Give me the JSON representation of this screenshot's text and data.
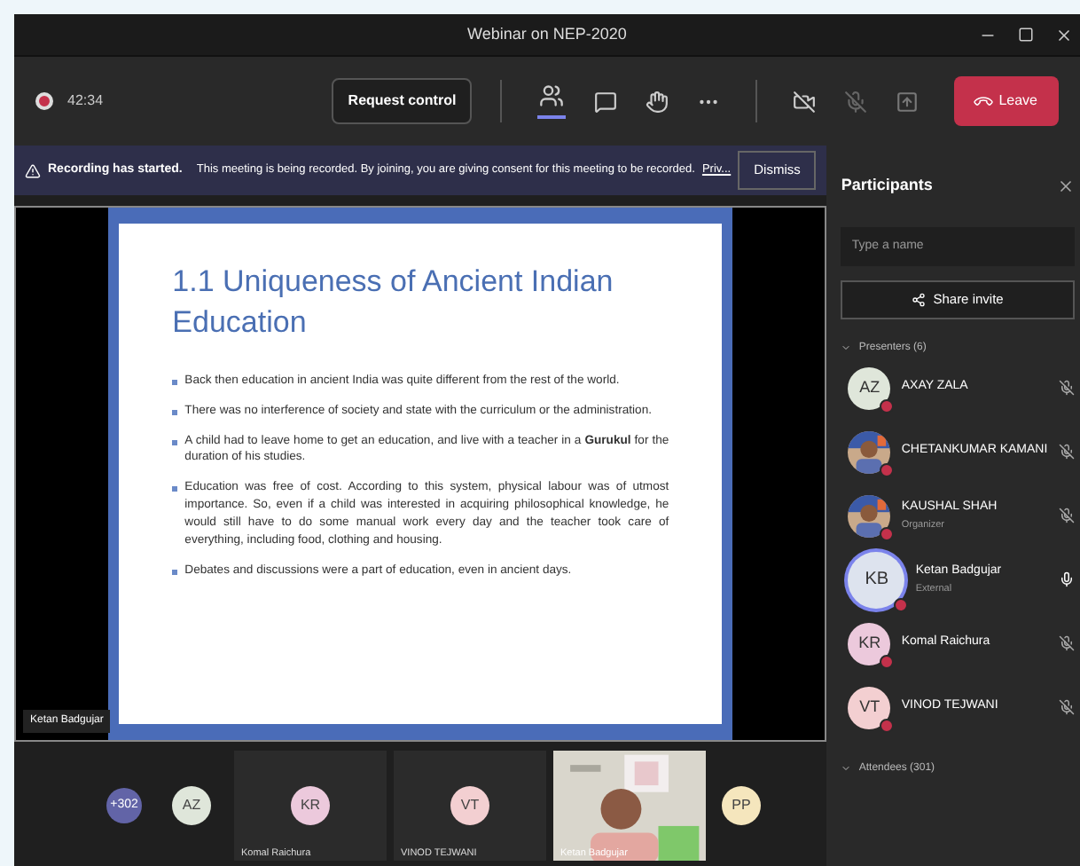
{
  "window": {
    "title": "Webinar on NEP-2020"
  },
  "toolbar": {
    "recording": true,
    "timer": "42:34",
    "request_control": "Request control",
    "people_selected": true,
    "leave": "Leave"
  },
  "banner": {
    "title": "Recording has started.",
    "message": "This meeting is being recorded. By joining, you are giving consent for this meeting to be recorded.",
    "link": "Priv...",
    "dismiss": "Dismiss"
  },
  "slide": {
    "title": "1.1 Uniqueness of Ancient Indian Education",
    "bullets": [
      "Back then education in ancient India was quite different from the rest of the world.",
      "There was no interference of society and state with the curriculum or the administration.",
      "A child had to leave home to get an education, and live with a teacher in a **Gurukul** for the duration of his studies.",
      "Education was free of cost. According to this system, physical labour was of utmost importance. So, even if a child was interested in acquiring philosophical knowledge, he would still have to do some manual work every day and the teacher took care of everything, including food, clothing and housing.",
      "Debates and discussions were a part of education, even in ancient days."
    ],
    "presenter": "Ketan Badgujar"
  },
  "gallery": [
    {
      "kind": "overflow",
      "label": "+302"
    },
    {
      "kind": "initials",
      "label": "AZ",
      "color": "#dfe6da"
    },
    {
      "kind": "initials",
      "label": "KR",
      "color": "#ecc9dc",
      "name": "Komal Raichura"
    },
    {
      "kind": "initials",
      "label": "VT",
      "color": "#f3cfd1",
      "name": "VINOD TEJWANI"
    },
    {
      "kind": "video",
      "name": "Ketan Badgujar"
    },
    {
      "kind": "initials",
      "label": "PP",
      "color": "#f5e6bd"
    }
  ],
  "participants": {
    "title": "Participants",
    "search_placeholder": "Type a name",
    "share_invite": "Share invite",
    "sections": [
      {
        "title": "Presenters (6)",
        "expanded": true,
        "people": [
          {
            "kind": "initials",
            "initials": "AZ",
            "color": "#dfe6da",
            "name": "AXAY ZALA",
            "muted": true,
            "speaking": false
          },
          {
            "name": "CHETANKUMAR KAMANI",
            "muted": true,
            "speaking": false
          },
          {
            "name": "KAUSHAL SHAH",
            "role": "Organizer",
            "muted": true,
            "speaking": false
          },
          {
            "kind": "initials",
            "initials": "KB",
            "color": "#dde3ee",
            "name": "Ketan Badgujar",
            "role": "External",
            "muted": false,
            "speaking": true
          },
          {
            "kind": "initials",
            "initials": "KR",
            "color": "#ecc9dc",
            "name": "Komal Raichura",
            "muted": true,
            "speaking": false
          },
          {
            "kind": "initials",
            "initials": "VT",
            "color": "#f3cfd1",
            "name": "VINOD TEJWANI",
            "muted": true,
            "speaking": false
          }
        ]
      },
      {
        "title": "Attendees (301)",
        "expanded": true
      }
    ]
  }
}
